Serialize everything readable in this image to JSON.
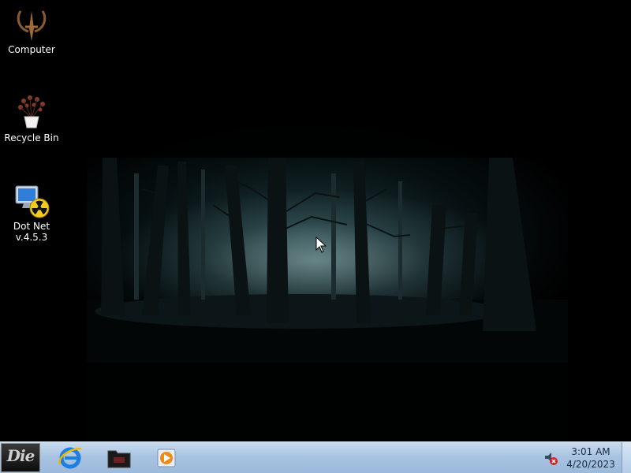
{
  "desktop": {
    "icons": [
      {
        "label": "Computer",
        "icon": "quake-logo-icon"
      },
      {
        "label": "Recycle Bin",
        "icon": "potted-plant-icon"
      },
      {
        "label": "Dot Net\nv.4.5.3",
        "icon": "computer-radiation-icon"
      }
    ],
    "wallpaper": "dark-misty-forest"
  },
  "taskbar": {
    "start_label": "Die",
    "pinned": [
      {
        "name": "Internet Explorer",
        "icon": "internet-explorer-icon"
      },
      {
        "name": "File Explorer",
        "icon": "folder-icon"
      },
      {
        "name": "Media Player",
        "icon": "media-player-icon"
      }
    ],
    "tray": {
      "volume_icon": "speaker-muted-icon",
      "time": "3:01 AM",
      "date": "4/20/2023"
    }
  },
  "colors": {
    "taskbar_top": "#c9dcef",
    "taskbar_bottom": "#9bb9db",
    "mist": "#aacdcd"
  }
}
